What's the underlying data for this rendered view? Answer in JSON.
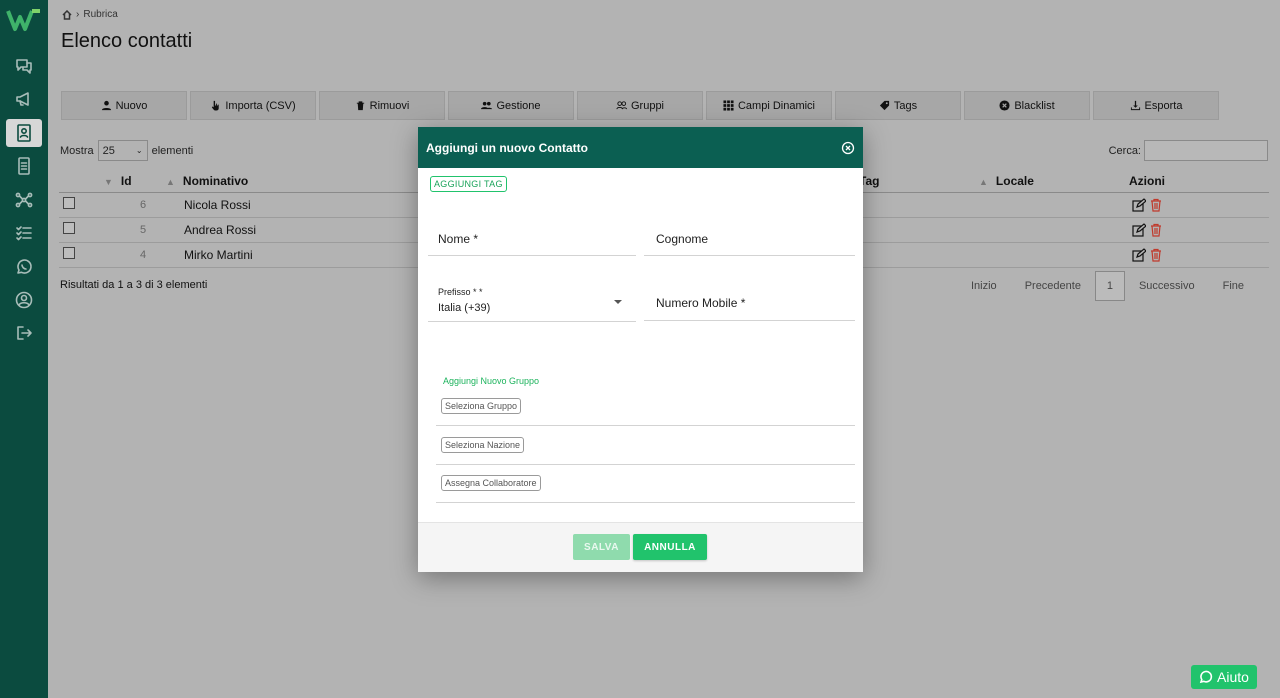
{
  "breadcrumb": {
    "label": "Rubrica"
  },
  "page": {
    "title": "Elenco contatti"
  },
  "toolbar": [
    {
      "label": "Nuovo",
      "icon": "user-icon"
    },
    {
      "label": "Importa (CSV)",
      "icon": "hand-pointer-icon"
    },
    {
      "label": "Rimuovi",
      "icon": "trash-icon"
    },
    {
      "label": "Gestione",
      "icon": "users-icon"
    },
    {
      "label": "Gruppi",
      "icon": "users-outline-icon"
    },
    {
      "label": "Campi Dinamici",
      "icon": "grid-icon"
    },
    {
      "label": "Tags",
      "icon": "tag-icon"
    },
    {
      "label": "Blacklist",
      "icon": "x-circle-icon"
    },
    {
      "label": "Esporta",
      "icon": "download-icon"
    }
  ],
  "table_controls": {
    "show_label": "Mostra",
    "show_value": "25",
    "elements_label": "elementi",
    "search_label": "Cerca:"
  },
  "table": {
    "headers": [
      "Id",
      "Nominativo",
      "Tag",
      "Locale",
      "Azioni"
    ],
    "rows": [
      {
        "id": "6",
        "name": "Nicola Rossi"
      },
      {
        "id": "5",
        "name": "Andrea Rossi"
      },
      {
        "id": "4",
        "name": "Mirko Martini"
      }
    ]
  },
  "results": "Risultati da 1 a 3 di 3 elementi",
  "pager": {
    "first": "Inizio",
    "prev": "Precedente",
    "current": "1",
    "next": "Successivo",
    "last": "Fine"
  },
  "modal": {
    "title": "Aggiungi un nuovo Contatto",
    "add_tag": "AGGIUNGI TAG",
    "first_name_label": "Nome *",
    "last_name_label": "Cognome",
    "prefix_label": "Prefisso * *",
    "prefix_value": "Italia (+39)",
    "mobile_label": "Numero Mobile *",
    "group_title": "Aggiungi Nuovo Gruppo",
    "select_group": "Seleziona Gruppo",
    "select_nation": "Seleziona Nazione",
    "assign_collaborator": "Assegna Collaboratore",
    "save": "SALVA",
    "cancel": "ANNULLA"
  },
  "help": {
    "label": "Aiuto"
  },
  "colors": {
    "sidebar": "#0b4b3f",
    "modal_header": "#0b5f52",
    "accent": "#21c36c",
    "delete_red": "#c0392b"
  }
}
